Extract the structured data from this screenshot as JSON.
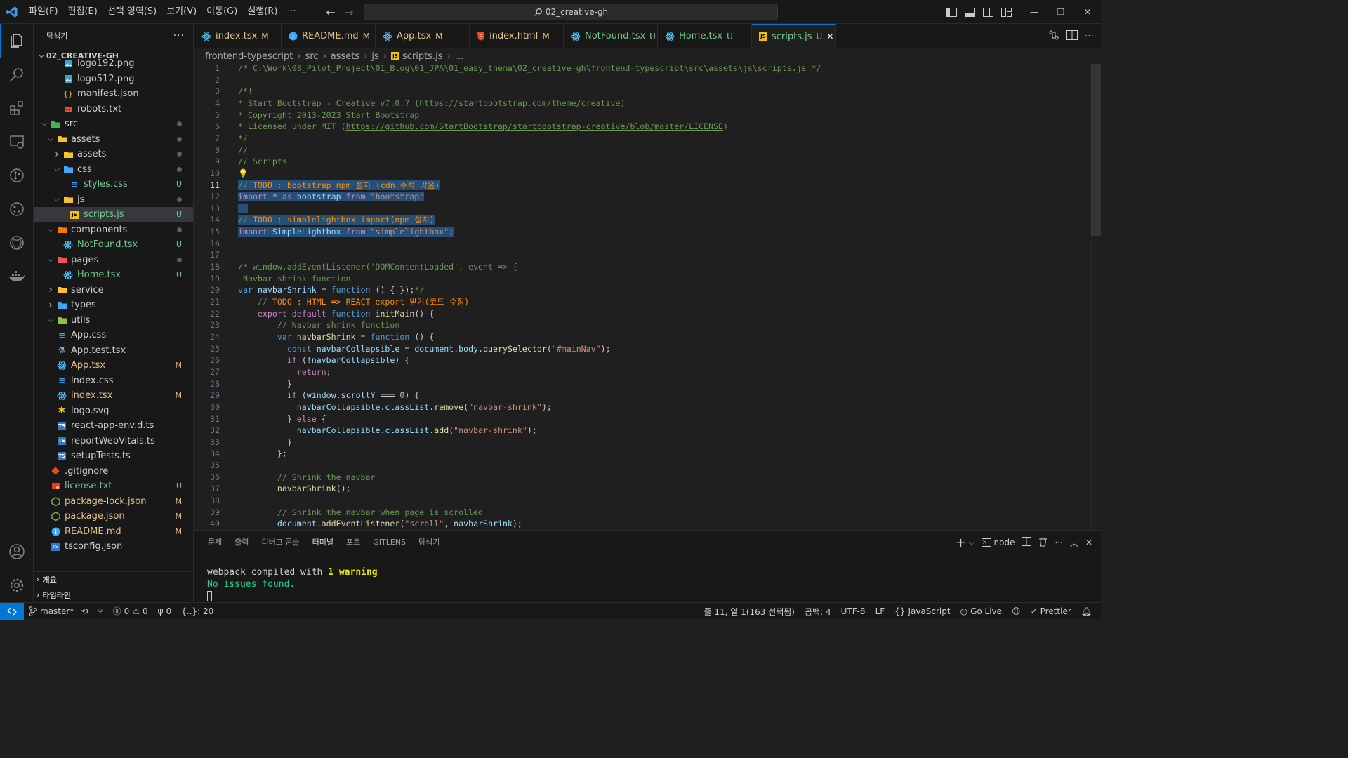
{
  "menu": [
    "파일(F)",
    "편집(E)",
    "선택 영역(S)",
    "보기(V)",
    "이동(G)",
    "실행(R)",
    "···"
  ],
  "command_center": {
    "text": "02_creative-gh"
  },
  "sidebar": {
    "title": "탐색기",
    "workspace": "02_CREATIVE-GH",
    "tree": [
      {
        "name": "logo192.png",
        "depth": 3,
        "icon": "image-icon",
        "kind": "file"
      },
      {
        "name": "logo512.png",
        "depth": 3,
        "icon": "image-icon",
        "kind": "file"
      },
      {
        "name": "manifest.json",
        "depth": 3,
        "icon": "json-icon",
        "kind": "file"
      },
      {
        "name": "robots.txt",
        "depth": 3,
        "icon": "robot-icon",
        "kind": "file"
      },
      {
        "name": "src",
        "depth": 1,
        "icon": "folder-src-icon",
        "kind": "folder-open",
        "deco": "dot"
      },
      {
        "name": "assets",
        "depth": 2,
        "icon": "folder-assets-icon",
        "kind": "folder-open",
        "deco": "dot"
      },
      {
        "name": "assets",
        "depth": 3,
        "icon": "folder-assets-icon",
        "kind": "folder-closed",
        "deco": "dot"
      },
      {
        "name": "css",
        "depth": 3,
        "icon": "folder-css-icon",
        "kind": "folder-open",
        "deco": "dot"
      },
      {
        "name": "styles.css",
        "depth": 4,
        "icon": "css-icon",
        "kind": "file",
        "deco": "U",
        "status": "untracked"
      },
      {
        "name": "js",
        "depth": 3,
        "icon": "folder-js-icon",
        "kind": "folder-open",
        "deco": "dot"
      },
      {
        "name": "scripts.js",
        "depth": 4,
        "icon": "js-icon",
        "kind": "file",
        "deco": "U",
        "status": "untracked",
        "selected": true
      },
      {
        "name": "components",
        "depth": 2,
        "icon": "folder-components-icon",
        "kind": "folder-open",
        "deco": "dot"
      },
      {
        "name": "NotFound.tsx",
        "depth": 3,
        "icon": "react-icon",
        "kind": "file",
        "deco": "U",
        "status": "untracked"
      },
      {
        "name": "pages",
        "depth": 2,
        "icon": "folder-pages-icon",
        "kind": "folder-open",
        "deco": "dot"
      },
      {
        "name": "Home.tsx",
        "depth": 3,
        "icon": "react-icon",
        "kind": "file",
        "deco": "U",
        "status": "untracked"
      },
      {
        "name": "service",
        "depth": 2,
        "icon": "folder-service-icon",
        "kind": "folder-closed"
      },
      {
        "name": "types",
        "depth": 2,
        "icon": "folder-types-icon",
        "kind": "folder-closed"
      },
      {
        "name": "utils",
        "depth": 2,
        "icon": "folder-utils-icon",
        "kind": "folder-open"
      },
      {
        "name": "App.css",
        "depth": 2,
        "icon": "css-icon",
        "kind": "file"
      },
      {
        "name": "App.test.tsx",
        "depth": 2,
        "icon": "test-icon",
        "kind": "file"
      },
      {
        "name": "App.tsx",
        "depth": 2,
        "icon": "react-icon",
        "kind": "file",
        "deco": "M",
        "status": "modified"
      },
      {
        "name": "index.css",
        "depth": 2,
        "icon": "css-icon",
        "kind": "file"
      },
      {
        "name": "index.tsx",
        "depth": 2,
        "icon": "react-icon",
        "kind": "file",
        "deco": "M",
        "status": "modified"
      },
      {
        "name": "logo.svg",
        "depth": 2,
        "icon": "svg-icon",
        "kind": "file"
      },
      {
        "name": "react-app-env.d.ts",
        "depth": 2,
        "icon": "ts-icon",
        "kind": "file"
      },
      {
        "name": "reportWebVitals.ts",
        "depth": 2,
        "icon": "ts-icon",
        "kind": "file"
      },
      {
        "name": "setupTests.ts",
        "depth": 2,
        "icon": "ts-icon",
        "kind": "file"
      },
      {
        "name": ".gitignore",
        "depth": 1,
        "icon": "git-icon",
        "kind": "file"
      },
      {
        "name": "license.txt",
        "depth": 1,
        "icon": "license-icon",
        "kind": "file",
        "deco": "U",
        "status": "untracked"
      },
      {
        "name": "package-lock.json",
        "depth": 1,
        "icon": "npm-icon",
        "kind": "file",
        "deco": "M",
        "status": "modified"
      },
      {
        "name": "package.json",
        "depth": 1,
        "icon": "npm-icon",
        "kind": "file",
        "deco": "M",
        "status": "modified"
      },
      {
        "name": "README.md",
        "depth": 1,
        "icon": "info-icon",
        "kind": "file",
        "deco": "M",
        "status": "modified"
      },
      {
        "name": "tsconfig.json",
        "depth": 1,
        "icon": "tsconfig-icon",
        "kind": "file"
      }
    ],
    "sections": [
      "개요",
      "타임라인"
    ]
  },
  "tabs": [
    {
      "name": "index.tsx",
      "status": "M",
      "icon": "react-icon"
    },
    {
      "name": "README.md",
      "status": "M",
      "icon": "info-icon"
    },
    {
      "name": "App.tsx",
      "status": "M",
      "icon": "react-icon"
    },
    {
      "name": "index.html",
      "status": "M",
      "icon": "html-icon"
    },
    {
      "name": "NotFound.tsx",
      "status": "U",
      "icon": "react-icon"
    },
    {
      "name": "Home.tsx",
      "status": "U",
      "icon": "react-icon"
    },
    {
      "name": "scripts.js",
      "status": "U",
      "icon": "js-icon",
      "active": true
    }
  ],
  "breadcrumb": [
    "frontend-typescript",
    "src",
    "assets",
    "js",
    "scripts.js",
    "..."
  ],
  "code": [
    {
      "n": 1,
      "h": "<span class=c>/* C:\\Work\\08_Pilot_Project\\01_Blog\\01_JPA\\01_easy_thema\\02_creative-gh\\frontend-typescript\\src\\assets\\js\\scripts.js */</span>"
    },
    {
      "n": 2,
      "h": ""
    },
    {
      "n": 3,
      "h": "<span class=c>/*!</span>"
    },
    {
      "n": 4,
      "h": "<span class=c>* Start Bootstrap - Creative v7.0.7 (<span class=ul>https://startbootstrap.com/theme/creative</span>)</span>"
    },
    {
      "n": 5,
      "h": "<span class=c>* Copyright 2013-2023 Start Bootstrap</span>"
    },
    {
      "n": 6,
      "h": "<span class=c>* Licensed under MIT (<span class=ul>https://github.com/StartBootstrap/startbootstrap-creative/blob/master/LICENSE</span>)</span>"
    },
    {
      "n": 7,
      "h": "<span class=c>*/</span>"
    },
    {
      "n": 8,
      "h": "<span class=c>//</span>"
    },
    {
      "n": 9,
      "h": "<span class=c>// Scripts</span>"
    },
    {
      "n": 10,
      "h": "<span class=fn>💡</span>"
    },
    {
      "n": 11,
      "h": "<span class=sel><span class=c>// </span><span class=todo>TODO : bootstrap npm 설치 (cdn 주석 막음)</span></span>",
      "cur": true
    },
    {
      "n": 12,
      "h": "<span class=sel><span class=kc>import</span> <span class=p>*</span> <span class=kc>as</span> <span class=v>bootstrap</span> <span class=kc>from</span> <span class=s>\"bootstrap\"</span></span>"
    },
    {
      "n": 13,
      "h": "<span class=sel>  </span>"
    },
    {
      "n": 14,
      "h": "<span class=sel><span class=c>// </span><span class=todo>TODO : simplelightbox import(npm 설치)</span></span>"
    },
    {
      "n": 15,
      "h": "<span class=sel><span class=kc>import</span> <span class=v>SimpleLightbox</span> <span class=kc>from</span> <span class=s>\"simplelightbox\"</span><span class=p>;</span></span>"
    },
    {
      "n": 16,
      "h": ""
    },
    {
      "n": 17,
      "h": ""
    },
    {
      "n": 18,
      "h": "<span class=c>/* window.addEventListener('DOMContentLoaded', event =&gt; {</span>"
    },
    {
      "n": 19,
      "h": "<span class=c> Navbar shrink function</span>"
    },
    {
      "n": 20,
      "h": "<span class=k>var</span> <span class=v>navbarShrink</span> <span class=p>=</span> <span class=k>function</span> <span class=p>() { });</span><span class=c>*/</span>"
    },
    {
      "n": 21,
      "h": "    <span class=c>// </span><span class=todo>TODO : HTML =&gt; REACT export 받기(코드 수정)</span>"
    },
    {
      "n": 22,
      "h": "    <span class=kc>export</span> <span class=kc>default</span> <span class=k>function</span> <span class=fn>initMain</span><span class=p>() {</span>"
    },
    {
      "n": 23,
      "h": "        <span class=c>// Navbar shrink function</span>"
    },
    {
      "n": 24,
      "h": "        <span class=k>var</span> <span class=fn>navbarShrink</span> <span class=p>=</span> <span class=k>function</span> <span class=p>() {</span>"
    },
    {
      "n": 25,
      "h": "          <span class=k>const</span> <span class=v>navbarCollapsible</span> <span class=p>=</span> <span class=v>document</span><span class=p>.</span><span class=v>body</span><span class=p>.</span><span class=fn>querySelector</span><span class=p>(</span><span class=s>\"#mainNav\"</span><span class=p>);</span>"
    },
    {
      "n": 26,
      "h": "          <span class=kc>if</span> <span class=p>(!</span><span class=v>navbarCollapsible</span><span class=p>) {</span>"
    },
    {
      "n": 27,
      "h": "            <span class=kc>return</span><span class=p>;</span>"
    },
    {
      "n": 28,
      "h": "          <span class=p>}</span>"
    },
    {
      "n": 29,
      "h": "          <span class=kc>if</span> <span class=p>(</span><span class=v>window</span><span class=p>.</span><span class=v>scrollY</span> <span class=p>===</span> <span class=n>0</span><span class=p>) {</span>"
    },
    {
      "n": 30,
      "h": "            <span class=v>navbarCollapsible</span><span class=p>.</span><span class=v>classList</span><span class=p>.</span><span class=fn>remove</span><span class=p>(</span><span class=s>\"navbar-shrink\"</span><span class=p>);</span>"
    },
    {
      "n": 31,
      "h": "          <span class=p>}</span> <span class=kc>else</span> <span class=p>{</span>"
    },
    {
      "n": 32,
      "h": "            <span class=v>navbarCollapsible</span><span class=p>.</span><span class=v>classList</span><span class=p>.</span><span class=fn>add</span><span class=p>(</span><span class=s>\"navbar-shrink\"</span><span class=p>);</span>"
    },
    {
      "n": 33,
      "h": "          <span class=p>}</span>"
    },
    {
      "n": 34,
      "h": "        <span class=p>};</span>"
    },
    {
      "n": 35,
      "h": ""
    },
    {
      "n": 36,
      "h": "        <span class=c>// Shrink the navbar</span>"
    },
    {
      "n": 37,
      "h": "        <span class=fn>navbarShrink</span><span class=p>();</span>"
    },
    {
      "n": 38,
      "h": ""
    },
    {
      "n": 39,
      "h": "        <span class=c>// Shrink the navbar when page is scrolled</span>"
    },
    {
      "n": 40,
      "h": "        <span class=v>document</span><span class=p>.</span><span class=fn>addEventListener</span><span class=p>(</span><span class=s>\"scroll\"</span><span class=p>,</span> <span class=v>navbarShrink</span><span class=p>);</span>"
    }
  ],
  "panel": {
    "tabs": [
      "문제",
      "출력",
      "디버그 콘솔",
      "터미널",
      "포트",
      "GITLENS",
      "탐색기"
    ],
    "active_tab": "터미널",
    "terminal_name": "node",
    "terminal": {
      "line1_prefix": "webpack compiled with ",
      "line1_warn": "1 warning",
      "line2": "No issues found."
    }
  },
  "status": {
    "branch": "master*",
    "errors": "0",
    "warnings": "0",
    "ports": "0",
    "indent_info": "{..}: 20",
    "position": "줄 11, 열 1(163 선택됨)",
    "spaces": "공백: 4",
    "encoding": "UTF-8",
    "eol": "LF",
    "language": "JavaScript",
    "golive": "Go Live",
    "prettier": "Prettier"
  },
  "colors": {
    "accent": "#0078d4",
    "modified": "#e2c08d",
    "untracked": "#73c991"
  }
}
